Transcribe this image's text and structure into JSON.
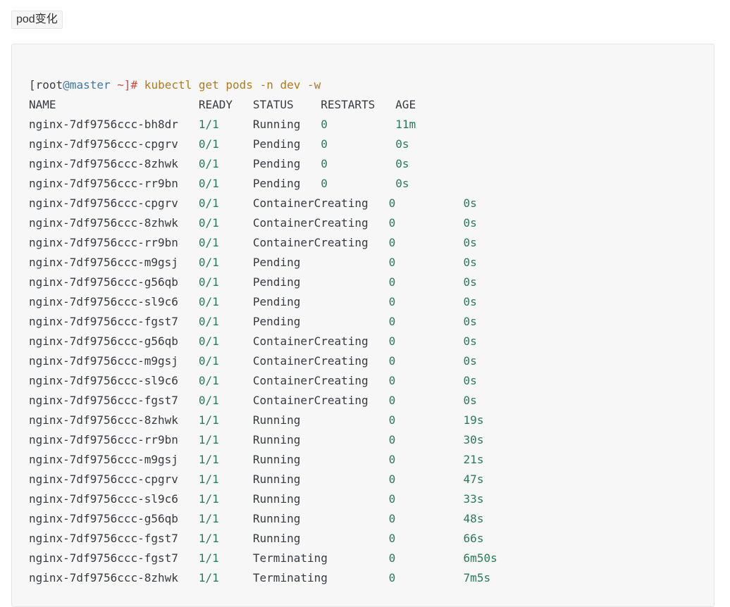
{
  "heading": "pod变化",
  "prompt": {
    "open": "[",
    "user": "root",
    "at": "@",
    "host": "master",
    "space": " ",
    "tilde": "~",
    "close": "]",
    "hash": "#",
    "command": " kubectl get pods -n dev -w"
  },
  "header_line": "NAME                     READY   STATUS    RESTARTS   AGE",
  "rows": [
    {
      "name": "nginx-7df9756ccc-bh8dr",
      "ready": "1/1",
      "status": "Running",
      "restarts": "0",
      "age": "11m",
      "layout": "a"
    },
    {
      "name": "nginx-7df9756ccc-cpgrv",
      "ready": "0/1",
      "status": "Pending",
      "restarts": "0",
      "age": "0s",
      "layout": "a"
    },
    {
      "name": "nginx-7df9756ccc-8zhwk",
      "ready": "0/1",
      "status": "Pending",
      "restarts": "0",
      "age": "0s",
      "layout": "a"
    },
    {
      "name": "nginx-7df9756ccc-rr9bn",
      "ready": "0/1",
      "status": "Pending",
      "restarts": "0",
      "age": "0s",
      "layout": "a"
    },
    {
      "name": "nginx-7df9756ccc-cpgrv",
      "ready": "0/1",
      "status": "ContainerCreating",
      "restarts": "0",
      "age": "0s",
      "layout": "b"
    },
    {
      "name": "nginx-7df9756ccc-8zhwk",
      "ready": "0/1",
      "status": "ContainerCreating",
      "restarts": "0",
      "age": "0s",
      "layout": "b"
    },
    {
      "name": "nginx-7df9756ccc-rr9bn",
      "ready": "0/1",
      "status": "ContainerCreating",
      "restarts": "0",
      "age": "0s",
      "layout": "b"
    },
    {
      "name": "nginx-7df9756ccc-m9gsj",
      "ready": "0/1",
      "status": "Pending",
      "restarts": "0",
      "age": "0s",
      "layout": "b"
    },
    {
      "name": "nginx-7df9756ccc-g56qb",
      "ready": "0/1",
      "status": "Pending",
      "restarts": "0",
      "age": "0s",
      "layout": "b"
    },
    {
      "name": "nginx-7df9756ccc-sl9c6",
      "ready": "0/1",
      "status": "Pending",
      "restarts": "0",
      "age": "0s",
      "layout": "b"
    },
    {
      "name": "nginx-7df9756ccc-fgst7",
      "ready": "0/1",
      "status": "Pending",
      "restarts": "0",
      "age": "0s",
      "layout": "b"
    },
    {
      "name": "nginx-7df9756ccc-g56qb",
      "ready": "0/1",
      "status": "ContainerCreating",
      "restarts": "0",
      "age": "0s",
      "layout": "b"
    },
    {
      "name": "nginx-7df9756ccc-m9gsj",
      "ready": "0/1",
      "status": "ContainerCreating",
      "restarts": "0",
      "age": "0s",
      "layout": "b"
    },
    {
      "name": "nginx-7df9756ccc-sl9c6",
      "ready": "0/1",
      "status": "ContainerCreating",
      "restarts": "0",
      "age": "0s",
      "layout": "b"
    },
    {
      "name": "nginx-7df9756ccc-fgst7",
      "ready": "0/1",
      "status": "ContainerCreating",
      "restarts": "0",
      "age": "0s",
      "layout": "b"
    },
    {
      "name": "nginx-7df9756ccc-8zhwk",
      "ready": "1/1",
      "status": "Running",
      "restarts": "0",
      "age": "19s",
      "layout": "b"
    },
    {
      "name": "nginx-7df9756ccc-rr9bn",
      "ready": "1/1",
      "status": "Running",
      "restarts": "0",
      "age": "30s",
      "layout": "b"
    },
    {
      "name": "nginx-7df9756ccc-m9gsj",
      "ready": "1/1",
      "status": "Running",
      "restarts": "0",
      "age": "21s",
      "layout": "b"
    },
    {
      "name": "nginx-7df9756ccc-cpgrv",
      "ready": "1/1",
      "status": "Running",
      "restarts": "0",
      "age": "47s",
      "layout": "b"
    },
    {
      "name": "nginx-7df9756ccc-sl9c6",
      "ready": "1/1",
      "status": "Running",
      "restarts": "0",
      "age": "33s",
      "layout": "b"
    },
    {
      "name": "nginx-7df9756ccc-g56qb",
      "ready": "1/1",
      "status": "Running",
      "restarts": "0",
      "age": "48s",
      "layout": "b"
    },
    {
      "name": "nginx-7df9756ccc-fgst7",
      "ready": "1/1",
      "status": "Running",
      "restarts": "0",
      "age": "66s",
      "layout": "b"
    },
    {
      "name": "nginx-7df9756ccc-fgst7",
      "ready": "1/1",
      "status": "Terminating",
      "restarts": "0",
      "age": "6m50s",
      "layout": "b"
    },
    {
      "name": "nginx-7df9756ccc-8zhwk",
      "ready": "1/1",
      "status": "Terminating",
      "restarts": "0",
      "age": "7m5s",
      "layout": "b"
    }
  ]
}
